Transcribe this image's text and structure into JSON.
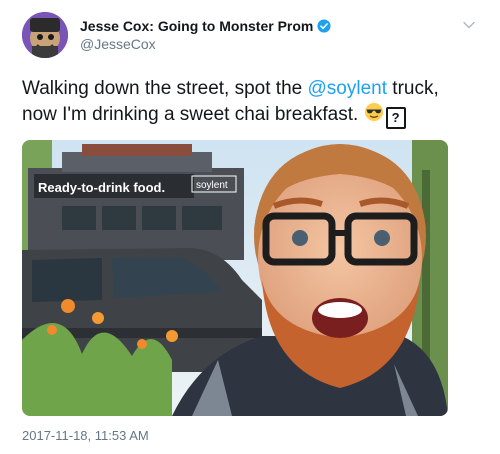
{
  "author": {
    "display_name": "Jesse Cox: Going to Monster Prom",
    "handle": "@JesseCox"
  },
  "tweet": {
    "text_part1": "Walking down the street, spot the ",
    "mention": "@soylent",
    "text_part2": " truck, now I'm drinking a sweet chai breakfast. ",
    "unknown_glyph": "?"
  },
  "media": {
    "truck_sign_text": "Ready-to-drink food.",
    "truck_brand": "soylent",
    "description": "selfie"
  },
  "timestamp": "2017-11-18, 11:53 AM",
  "colors": {
    "link": "#1da1f2",
    "verified": "#1da1f2",
    "secondary_text": "#657786"
  },
  "icons": [
    "verified-badge-icon",
    "chevron-down-icon",
    "sunglasses-emoji-icon"
  ]
}
